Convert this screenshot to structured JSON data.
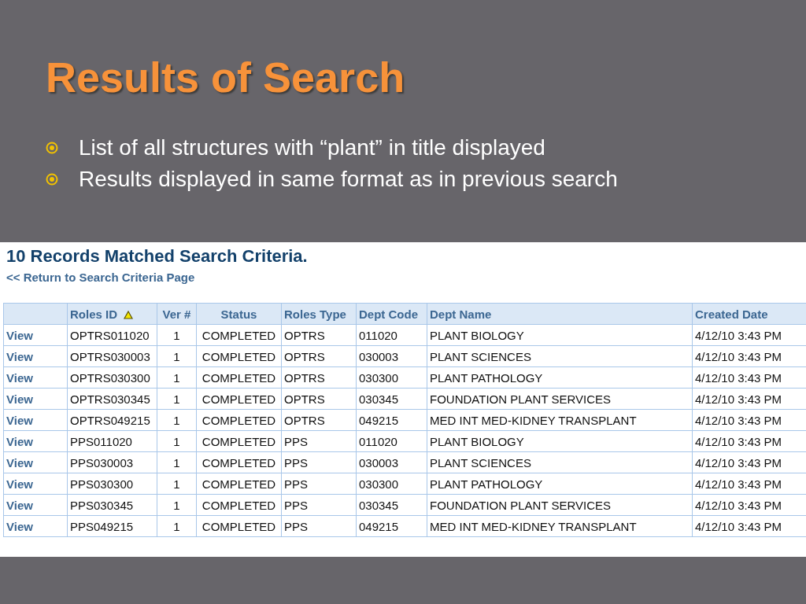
{
  "slide": {
    "title": "Results of Search",
    "bullets": [
      "List of all structures with “plant” in title displayed",
      "Results displayed in same format as in previous search"
    ]
  },
  "screenshot": {
    "heading": "10 Records Matched Search Criteria.",
    "back_link": "<< Return to Search Criteria Page",
    "table": {
      "columns": [
        {
          "sorted": false
        },
        {
          "label": "Roles ID",
          "sorted": true
        },
        {
          "label": "Ver #",
          "sorted": false
        },
        {
          "label": "Status",
          "sorted": false
        },
        {
          "label": "Roles Type",
          "sorted": false
        },
        {
          "label": "Dept Code",
          "sorted": false
        },
        {
          "label": "Dept Name",
          "sorted": false
        },
        {
          "label": "Created Date",
          "sorted": false
        }
      ],
      "rows": [
        [
          "View",
          "OPTRS011020",
          "1",
          "COMPLETED",
          "OPTRS",
          "011020",
          "PLANT BIOLOGY",
          "4/12/10 3:43 PM"
        ],
        [
          "View",
          "OPTRS030003",
          "1",
          "COMPLETED",
          "OPTRS",
          "030003",
          "PLANT SCIENCES",
          "4/12/10 3:43 PM"
        ],
        [
          "View",
          "OPTRS030300",
          "1",
          "COMPLETED",
          "OPTRS",
          "030300",
          "PLANT PATHOLOGY",
          "4/12/10 3:43 PM"
        ],
        [
          "View",
          "OPTRS030345",
          "1",
          "COMPLETED",
          "OPTRS",
          "030345",
          "FOUNDATION PLANT SERVICES",
          "4/12/10 3:43 PM"
        ],
        [
          "View",
          "OPTRS049215",
          "1",
          "COMPLETED",
          "OPTRS",
          "049215",
          "MED INT MED-KIDNEY TRANSPLANT",
          "4/12/10 3:43 PM"
        ],
        [
          "View",
          "PPS011020",
          "1",
          "COMPLETED",
          "PPS",
          "011020",
          "PLANT BIOLOGY",
          "4/12/10 3:43 PM"
        ],
        [
          "View",
          "PPS030003",
          "1",
          "COMPLETED",
          "PPS",
          "030003",
          "PLANT SCIENCES",
          "4/12/10 3:43 PM"
        ],
        [
          "View",
          "PPS030300",
          "1",
          "COMPLETED",
          "PPS",
          "030300",
          "PLANT PATHOLOGY",
          "4/12/10 3:43 PM"
        ],
        [
          "View",
          "PPS030345",
          "1",
          "COMPLETED",
          "PPS",
          "030345",
          "FOUNDATION PLANT SERVICES",
          "4/12/10 3:43 PM"
        ],
        [
          "View",
          "PPS049215",
          "1",
          "COMPLETED",
          "PPS",
          "049215",
          "MED INT MED-KIDNEY TRANSPLANT",
          "4/12/10 3:43 PM"
        ]
      ]
    }
  }
}
